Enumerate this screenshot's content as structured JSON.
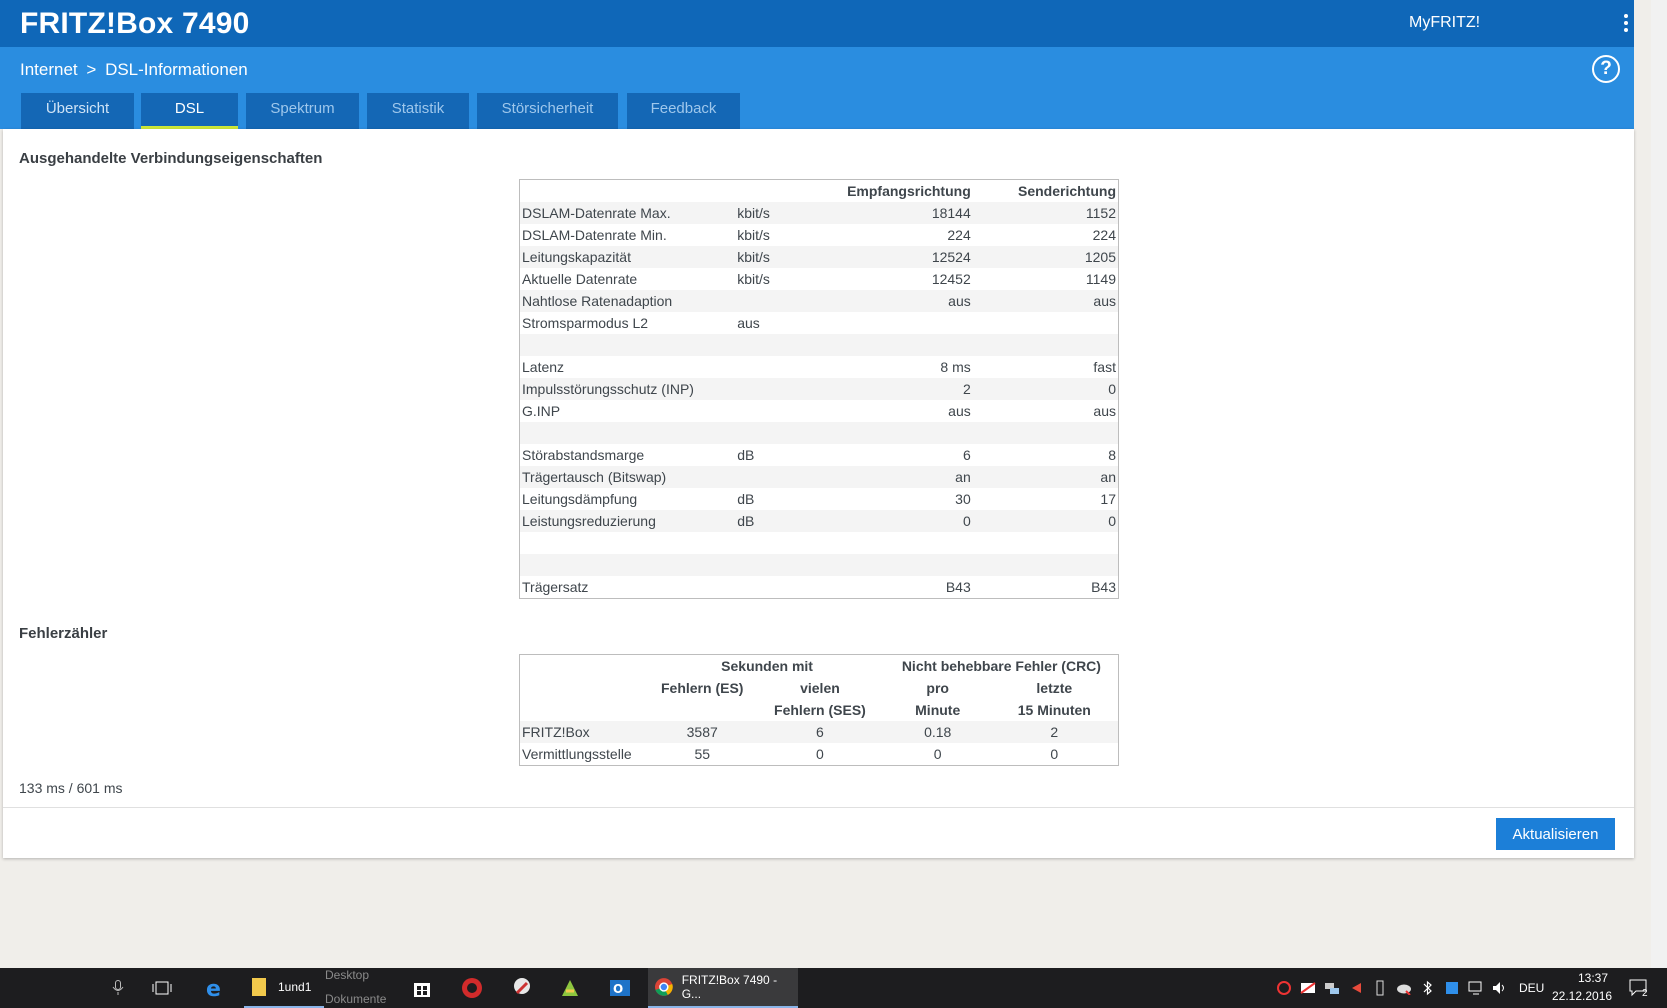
{
  "header": {
    "title": "FRITZ!Box 7490",
    "myfritz": "MyFRITZ!"
  },
  "breadcrumb": {
    "root": "Internet",
    "separator": ">",
    "current": "DSL-Informationen"
  },
  "tabs": [
    {
      "label": "Übersicht"
    },
    {
      "label": "DSL"
    },
    {
      "label": "Spektrum"
    },
    {
      "label": "Statistik"
    },
    {
      "label": "Störsicherheit"
    },
    {
      "label": "Feedback"
    }
  ],
  "section1": {
    "title": "Ausgehandelte Verbindungseigenschaften",
    "headers": {
      "down": "Empfangsrichtung",
      "up": "Senderichtung"
    },
    "rows": [
      {
        "label": "DSLAM-Datenrate Max.",
        "unit": "kbit/s",
        "down": "18144",
        "up": "1152"
      },
      {
        "label": "DSLAM-Datenrate Min.",
        "unit": "kbit/s",
        "down": "224",
        "up": "224"
      },
      {
        "label": "Leitungskapazität",
        "unit": "kbit/s",
        "down": "12524",
        "up": "1205"
      },
      {
        "label": "Aktuelle Datenrate",
        "unit": "kbit/s",
        "down": "12452",
        "up": "1149"
      },
      {
        "label": "Nahtlose Ratenadaption",
        "unit": "",
        "down": "aus",
        "up": "aus"
      },
      {
        "label": "Stromsparmodus L2",
        "unit": "aus",
        "down": "",
        "up": ""
      },
      {
        "label": "",
        "unit": "",
        "down": "",
        "up": ""
      },
      {
        "label": "Latenz",
        "unit": "",
        "down": "8 ms",
        "up": "fast"
      },
      {
        "label": "Impulsstörungsschutz (INP)",
        "unit": "",
        "down": "2",
        "up": "0"
      },
      {
        "label": "G.INP",
        "unit": "",
        "down": "aus",
        "up": "aus"
      },
      {
        "label": "",
        "unit": "",
        "down": "",
        "up": ""
      },
      {
        "label": "Störabstandsmarge",
        "unit": "dB",
        "down": "6",
        "up": "8"
      },
      {
        "label": "Trägertausch (Bitswap)",
        "unit": "",
        "down": "an",
        "up": "an"
      },
      {
        "label": "Leitungsdämpfung",
        "unit": "dB",
        "down": "30",
        "up": "17"
      },
      {
        "label": "Leistungsreduzierung",
        "unit": "dB",
        "down": "0",
        "up": "0"
      },
      {
        "label": "",
        "unit": "",
        "down": "",
        "up": ""
      },
      {
        "label": "",
        "unit": "",
        "down": "",
        "up": ""
      },
      {
        "label": "Trägersatz",
        "unit": "",
        "down": "B43",
        "up": "B43"
      }
    ]
  },
  "section2": {
    "title": "Fehlerzähler",
    "group1": "Sekunden mit",
    "group2": "Nicht behebbare Fehler (CRC)",
    "col_es": "Fehlern (ES)",
    "col_ses_1": "vielen",
    "col_ses_2": "Fehlern (SES)",
    "col_pm_1": "pro",
    "col_pm_2": "Minute",
    "col_l15_1": "letzte",
    "col_l15_2": "15 Minuten",
    "rows": [
      {
        "label": "FRITZ!Box",
        "es": "3587",
        "ses": "6",
        "pm": "0.18",
        "l15": "2"
      },
      {
        "label": "Vermittlungsstelle",
        "es": "55",
        "ses": "0",
        "pm": "0",
        "l15": "0"
      }
    ]
  },
  "timing": "133 ms / 601 ms",
  "refresh_label": "Aktualisieren",
  "taskbar": {
    "explorer_label": "1und1",
    "folder1": "Desktop",
    "folder2": "Dokumente",
    "chrome_label": "FRITZ!Box 7490 - G...",
    "lang": "DEU",
    "time": "13:37",
    "date": "22.12.2016",
    "notif_count": "2"
  }
}
